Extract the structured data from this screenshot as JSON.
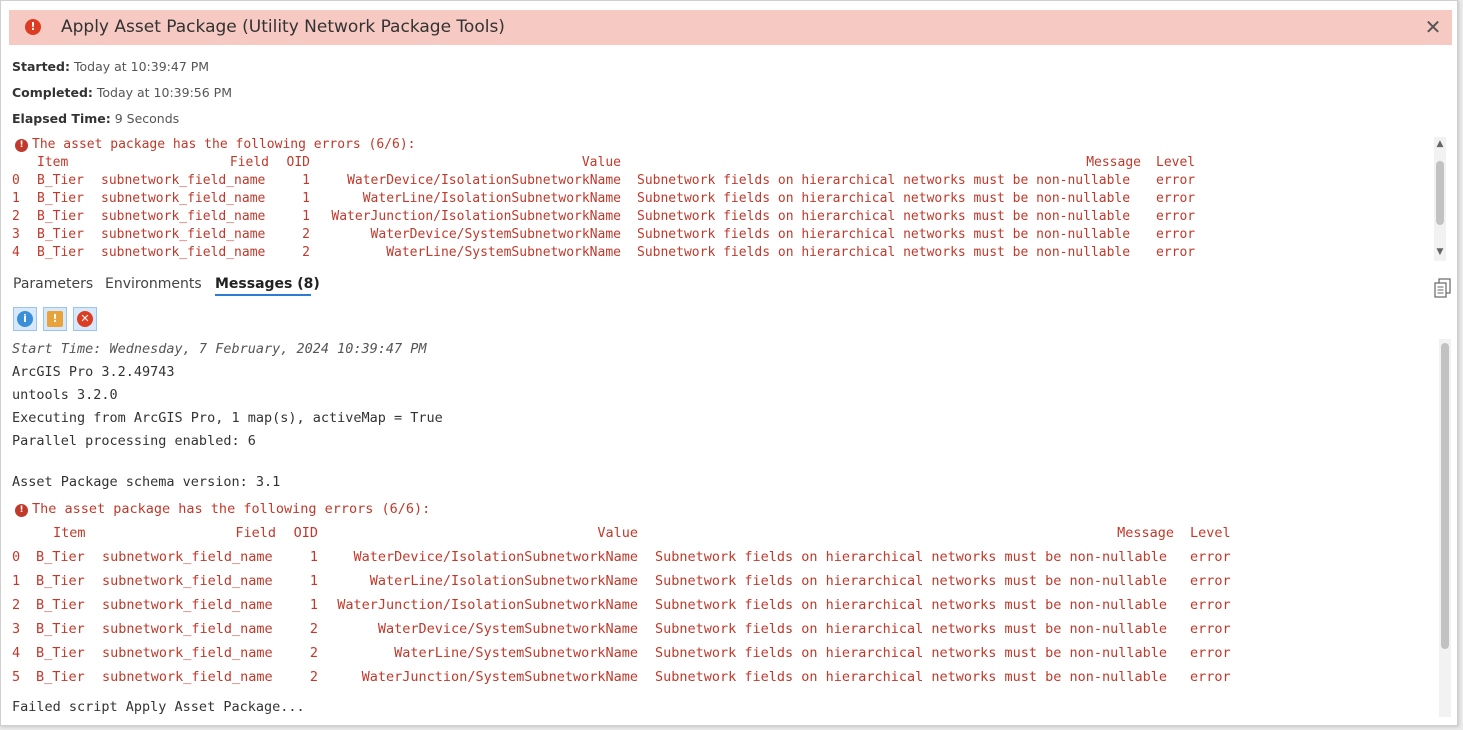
{
  "window": {
    "title": "Apply Asset Package (Utility Network Package Tools)",
    "close_glyph": "✕",
    "status_color": "#dc3c22"
  },
  "run_info": {
    "started_label": "Started:",
    "started_value": "Today at 10:39:47 PM",
    "completed_label": "Completed:",
    "completed_value": "Today at 10:39:56 PM",
    "elapsed_label": "Elapsed Time:",
    "elapsed_value": "9 Seconds"
  },
  "summary": {
    "error_heading": "The asset package has the following errors (6/6):",
    "columns": [
      "Item",
      "Field",
      "OID",
      "Value",
      "Message",
      "Level"
    ],
    "rows": [
      {
        "idx": "0",
        "item": "B_Tier",
        "field": "subnetwork_field_name",
        "oid": "1",
        "value": "WaterDevice/IsolationSubnetworkName",
        "message": "Subnetwork fields on hierarchical networks must be non-nullable",
        "level": "error"
      },
      {
        "idx": "1",
        "item": "B_Tier",
        "field": "subnetwork_field_name",
        "oid": "1",
        "value": "WaterLine/IsolationSubnetworkName",
        "message": "Subnetwork fields on hierarchical networks must be non-nullable",
        "level": "error"
      },
      {
        "idx": "2",
        "item": "B_Tier",
        "field": "subnetwork_field_name",
        "oid": "1",
        "value": "WaterJunction/IsolationSubnetworkName",
        "message": "Subnetwork fields on hierarchical networks must be non-nullable",
        "level": "error"
      },
      {
        "idx": "3",
        "item": "B_Tier",
        "field": "subnetwork_field_name",
        "oid": "2",
        "value": "WaterDevice/SystemSubnetworkName",
        "message": "Subnetwork fields on hierarchical networks must be non-nullable",
        "level": "error"
      },
      {
        "idx": "4",
        "item": "B_Tier",
        "field": "subnetwork_field_name",
        "oid": "2",
        "value": "WaterLine/SystemSubnetworkName",
        "message": "Subnetwork fields on hierarchical networks must be non-nullable",
        "level": "error"
      }
    ]
  },
  "tabs": [
    {
      "label": "Parameters",
      "active": false
    },
    {
      "label": "Environments",
      "active": false
    },
    {
      "label": "Messages (8)",
      "active": true
    }
  ],
  "filters": [
    {
      "icon": "info-icon",
      "glyph": "i",
      "color": "#3b8fd8"
    },
    {
      "icon": "warning-icon",
      "glyph": "!",
      "color": "#e8a33a"
    },
    {
      "icon": "error-icon",
      "glyph": "✕",
      "color": "#dc3c22"
    }
  ],
  "messages": {
    "start_time": "Start Time: Wednesday, 7 February, 2024 10:39:47 PM",
    "lines": [
      "ArcGIS Pro 3.2.49743",
      "untools 3.2.0",
      "Executing from ArcGIS Pro, 1 map(s), activeMap = True",
      "Parallel processing enabled: 6"
    ],
    "schema_line": "Asset Package schema version: 3.1",
    "error_heading": "The asset package has the following errors (6/6):",
    "columns": [
      "Item",
      "Field",
      "OID",
      "Value",
      "Message",
      "Level"
    ],
    "rows": [
      {
        "idx": "0",
        "item": "B_Tier",
        "field": "subnetwork_field_name",
        "oid": "1",
        "value": "WaterDevice/IsolationSubnetworkName",
        "message": "Subnetwork fields on hierarchical networks must be non-nullable",
        "level": "error"
      },
      {
        "idx": "1",
        "item": "B_Tier",
        "field": "subnetwork_field_name",
        "oid": "1",
        "value": "WaterLine/IsolationSubnetworkName",
        "message": "Subnetwork fields on hierarchical networks must be non-nullable",
        "level": "error"
      },
      {
        "idx": "2",
        "item": "B_Tier",
        "field": "subnetwork_field_name",
        "oid": "1",
        "value": "WaterJunction/IsolationSubnetworkName",
        "message": "Subnetwork fields on hierarchical networks must be non-nullable",
        "level": "error"
      },
      {
        "idx": "3",
        "item": "B_Tier",
        "field": "subnetwork_field_name",
        "oid": "2",
        "value": "WaterDevice/SystemSubnetworkName",
        "message": "Subnetwork fields on hierarchical networks must be non-nullable",
        "level": "error"
      },
      {
        "idx": "4",
        "item": "B_Tier",
        "field": "subnetwork_field_name",
        "oid": "2",
        "value": "WaterLine/SystemSubnetworkName",
        "message": "Subnetwork fields on hierarchical networks must be non-nullable",
        "level": "error"
      },
      {
        "idx": "5",
        "item": "B_Tier",
        "field": "subnetwork_field_name",
        "oid": "2",
        "value": "WaterJunction/SystemSubnetworkName",
        "message": "Subnetwork fields on hierarchical networks must be non-nullable",
        "level": "error"
      }
    ],
    "footer": "Failed script Apply Asset Package..."
  },
  "colors": {
    "error_text": "#c0392b",
    "title_bar": "#f6cac3",
    "active_tab_underline": "#2c7bd4"
  }
}
